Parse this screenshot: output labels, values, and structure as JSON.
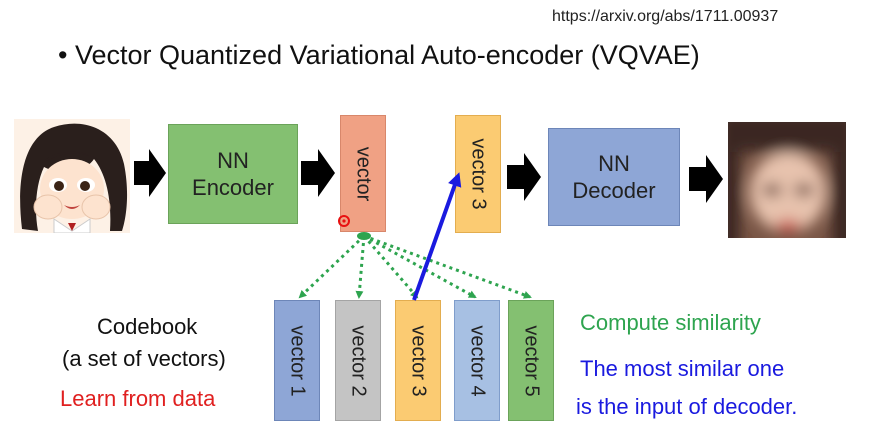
{
  "url": "https://arxiv.org/abs/1711.00937",
  "title": "• Vector Quantized Variational Auto-encoder (VQVAE)",
  "encoder_label": "NN\nEncoder",
  "decoder_label": "NN\nDecoder",
  "encoder_vector_label": "vector",
  "selected_vector_label": "vector 3",
  "codebook": [
    {
      "label": "vector 1",
      "color": "#8ea6d6"
    },
    {
      "label": "vector 2",
      "color": "#c4c4c4"
    },
    {
      "label": "vector 3",
      "color": "#fbcb72"
    },
    {
      "label": "vector 4",
      "color": "#a7c0e3"
    },
    {
      "label": "vector 5",
      "color": "#84c071"
    }
  ],
  "codebook_title": "Codebook",
  "codebook_subtitle": "(a set of vectors)",
  "learn_text": "Learn from data",
  "compute_text": "Compute similarity",
  "most_similar_text": "The most similar one",
  "input_text": "is the input of decoder.",
  "colors": {
    "arrow_black": "#000000",
    "similarity_green": "#2ea44f",
    "selected_blue": "#1a1adf",
    "learn_red": "#e02020"
  }
}
